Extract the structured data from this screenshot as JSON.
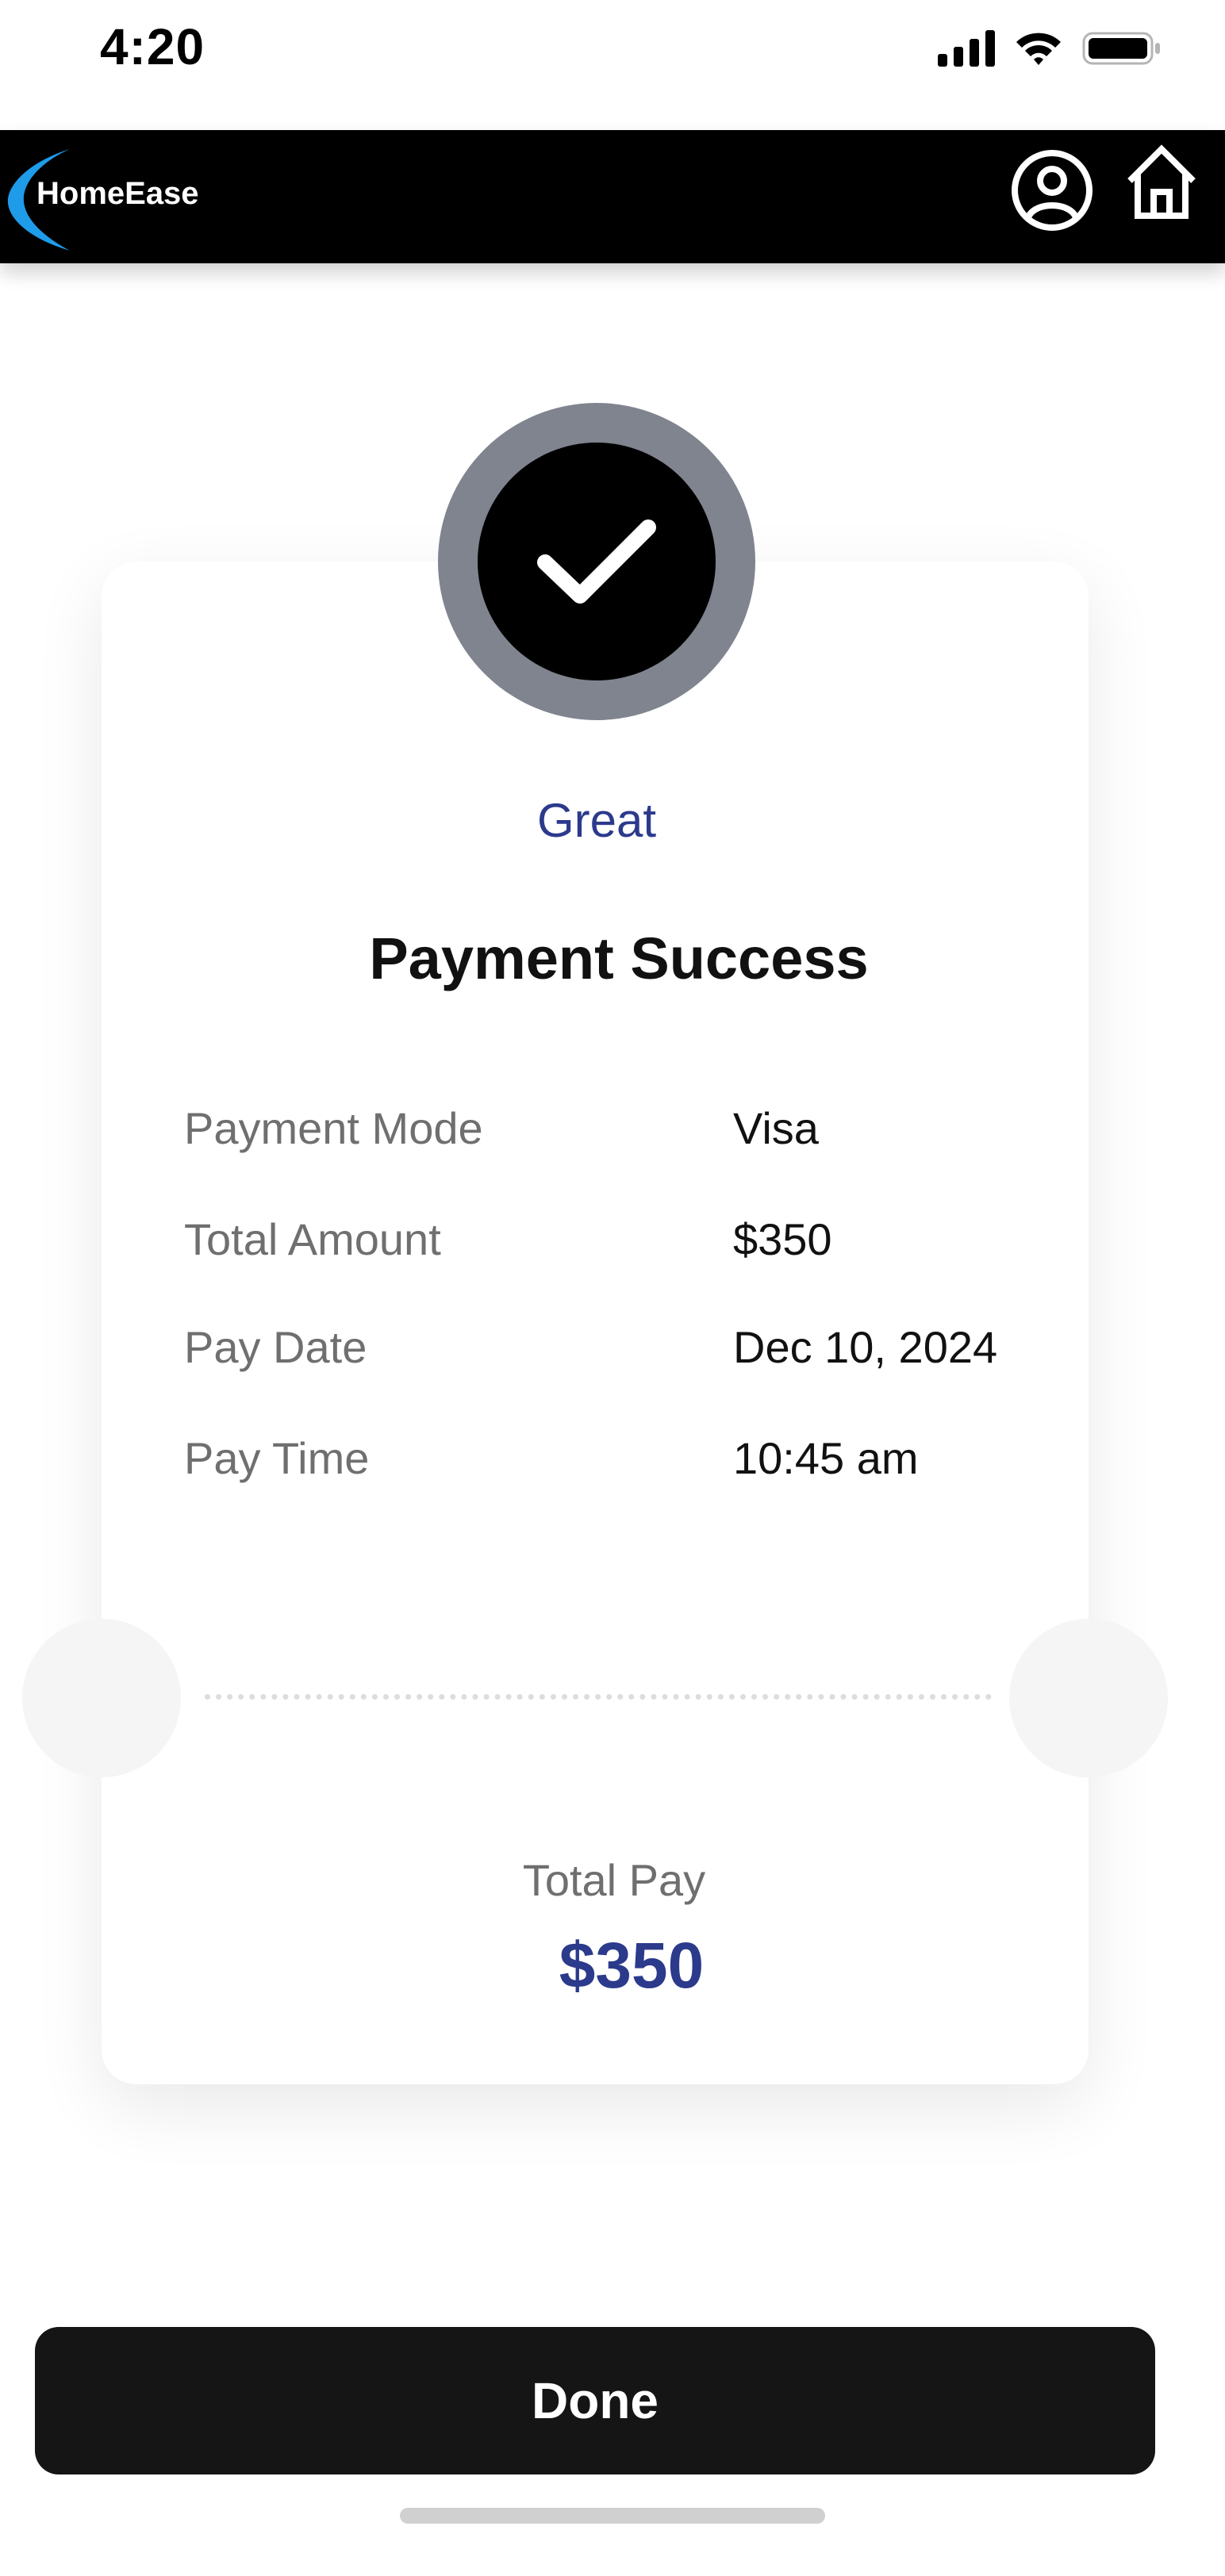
{
  "status_bar": {
    "time": "4:20",
    "icons": [
      "cellular-signal-icon",
      "wifi-icon",
      "battery-icon"
    ]
  },
  "header": {
    "logo_text": "HomeEase",
    "logo_accent_color": "#1e9be9",
    "icons": [
      "profile-icon",
      "home-icon"
    ]
  },
  "receipt": {
    "badge_icon": "checkmark-icon",
    "greeting": "Great",
    "title": "Payment Success",
    "rows": [
      {
        "label": "Payment Mode",
        "value": "Visa"
      },
      {
        "label": "Total Amount",
        "value": "$350"
      },
      {
        "label": "Pay Date",
        "value": "Dec 10, 2024"
      },
      {
        "label": "Pay Time",
        "value": "10:45 am"
      }
    ],
    "total_label": "Total Pay",
    "total_value": "$350"
  },
  "actions": {
    "done_label": "Done"
  },
  "colors": {
    "accent": "#2c3a8c",
    "header_bg": "#000000",
    "badge_ring": "#80848f",
    "button_bg": "#151515"
  }
}
